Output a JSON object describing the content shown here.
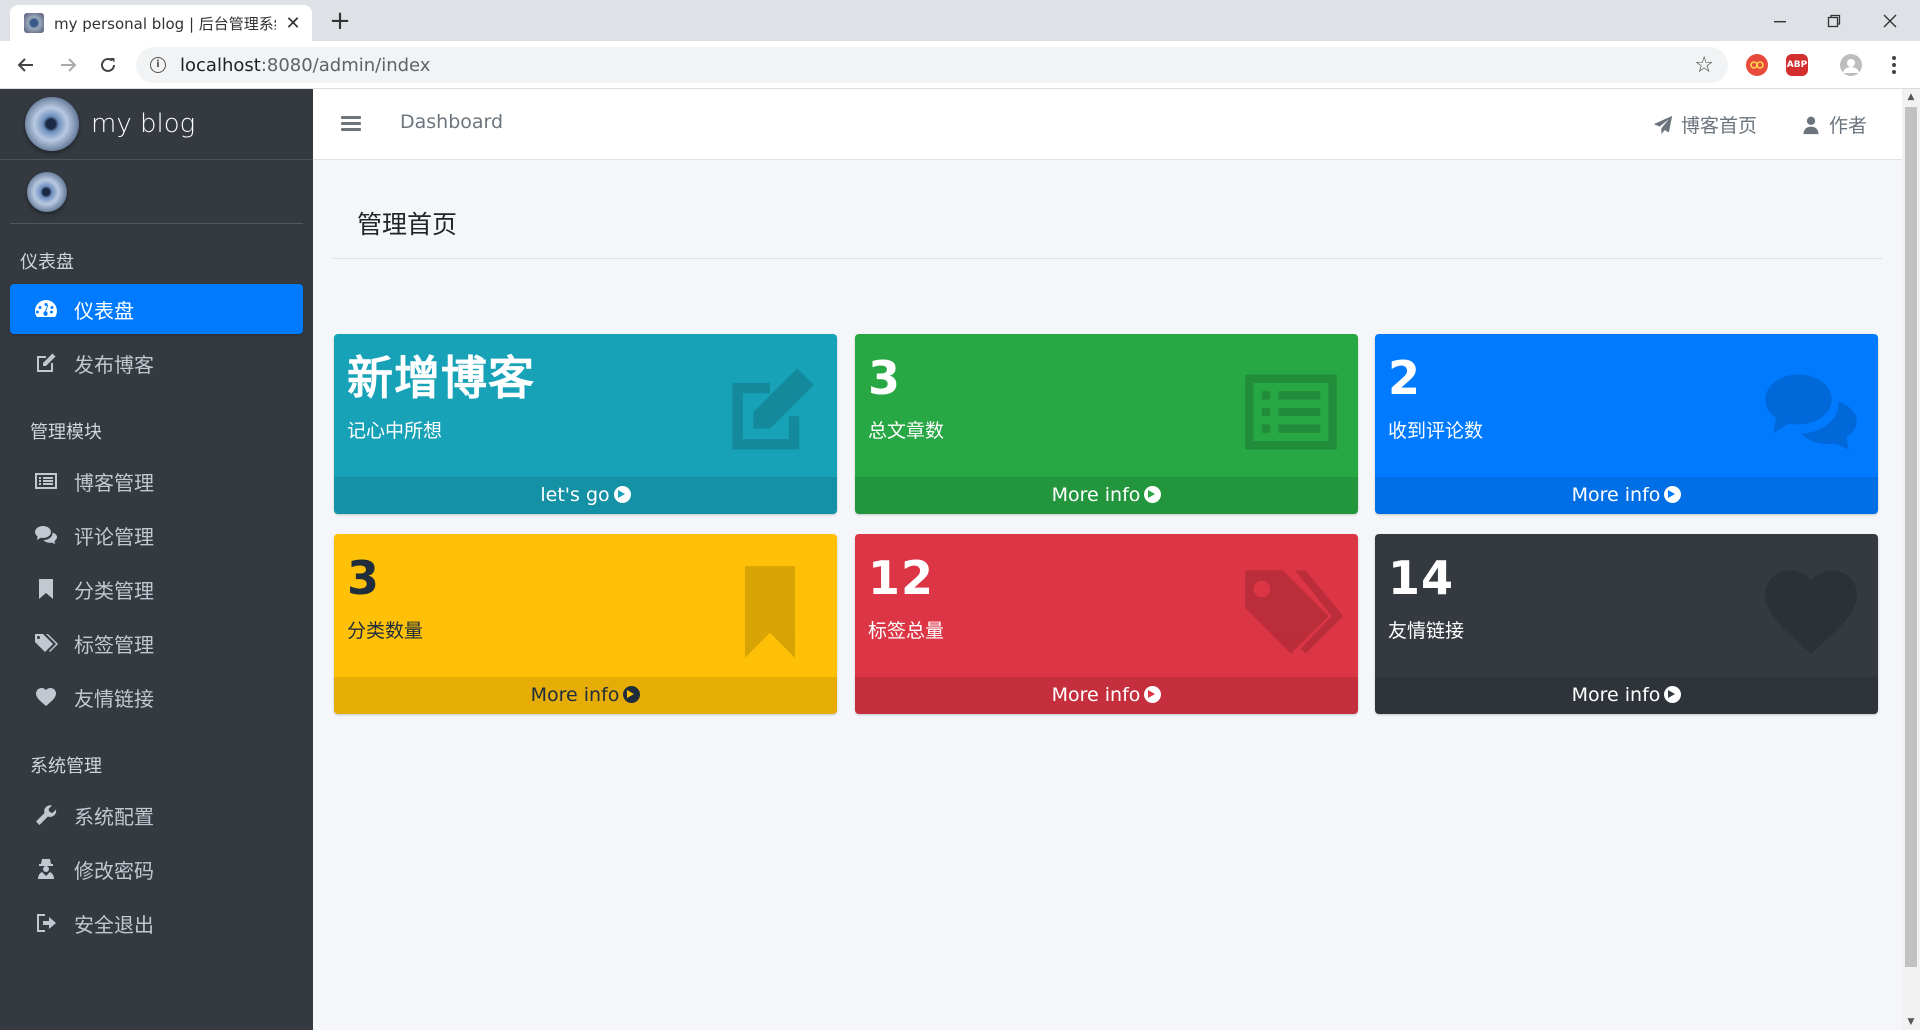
{
  "browser": {
    "tab_title": "my personal blog | 后台管理系统",
    "tab_close": "✕",
    "new_tab": "+",
    "url_host": "localhost",
    "url_rest": ":8080/admin/index",
    "ext_adblock": "ABP"
  },
  "sidebar": {
    "brand": "my blog",
    "sections": [
      {
        "header": "仪表盘"
      },
      {
        "header": "管理模块"
      },
      {
        "header": "系统管理"
      }
    ],
    "items": [
      {
        "label": "仪表盘",
        "icon": "dashboard-icon",
        "active": true
      },
      {
        "label": "发布博客",
        "icon": "edit-icon"
      },
      {
        "label": "博客管理",
        "icon": "list-icon"
      },
      {
        "label": "评论管理",
        "icon": "comments-icon"
      },
      {
        "label": "分类管理",
        "icon": "bookmark-icon"
      },
      {
        "label": "标签管理",
        "icon": "tags-icon"
      },
      {
        "label": "友情链接",
        "icon": "heart-icon"
      },
      {
        "label": "系统配置",
        "icon": "wrench-icon"
      },
      {
        "label": "修改密码",
        "icon": "user-secret-icon"
      },
      {
        "label": "安全退出",
        "icon": "sign-out-icon"
      }
    ]
  },
  "topnav": {
    "breadcrumb": "Dashboard",
    "blog_home": "博客首页",
    "author": "作者"
  },
  "content": {
    "title": "管理首页",
    "boxes": [
      {
        "value": "新增博客",
        "label": "记心中所想",
        "footer": "let's go",
        "color": "#17a2b8",
        "icon": "edit-icon"
      },
      {
        "value": "3",
        "label": "总文章数",
        "footer": "More info",
        "color": "#28a745",
        "icon": "list-alt-icon"
      },
      {
        "value": "2",
        "label": "收到评论数",
        "footer": "More info",
        "color": "#007bff",
        "icon": "comments-icon"
      },
      {
        "value": "3",
        "label": "分类数量",
        "footer": "More info",
        "color": "#ffc107",
        "icon": "bookmark-icon"
      },
      {
        "value": "12",
        "label": "标签总量",
        "footer": "More info",
        "color": "#dc3545",
        "icon": "tags-icon"
      },
      {
        "value": "14",
        "label": "友情链接",
        "footer": "More info",
        "color": "#343a40",
        "icon": "heart-icon"
      }
    ]
  }
}
